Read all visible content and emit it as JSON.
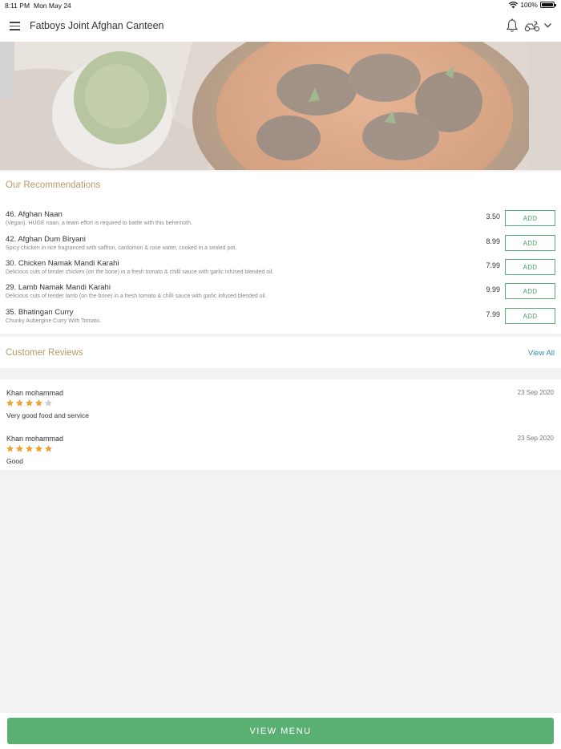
{
  "status_bar": {
    "time": "8:11 PM",
    "date": "Mon May 24",
    "battery": "100%"
  },
  "header": {
    "title": "Fatboys Joint Afghan Canteen",
    "icons": [
      "menu-icon",
      "bell-icon",
      "scooter-icon",
      "chevron-down-icon"
    ]
  },
  "recommendations": {
    "title": "Our Recommendations",
    "items": [
      {
        "name": "46. Afghan Naan",
        "desc": "(Vegan). HUGE naan, a team effort is required to battle with this behemoth.",
        "price": "3.50",
        "button": "ADD"
      },
      {
        "name": "42. Afghan Dum Biryani",
        "desc": "Spicy chicken in rice fragranced with saffron, cardomon & rose water, cooked in a sealed pot.",
        "price": "8.99",
        "button": "ADD"
      },
      {
        "name": "30. Chicken Namak Mandi Karahi",
        "desc": "Delicious cuts of tender chicken (on the bone) in a fresh tomato & chilli sauce with garlic infused blended oil.",
        "price": "7.99",
        "button": "ADD"
      },
      {
        "name": "29. Lamb Namak Mandi Karahi",
        "desc": "Delicious cuts of tender lamb (on the bone) in a fresh tomato & chilli sauce with garlic infused blended oil.",
        "price": "9.99",
        "button": "ADD"
      },
      {
        "name": "35. Bhatingan Curry",
        "desc": "Chunky Aubergine Curry With Tomato.",
        "price": "7.99",
        "button": "ADD"
      }
    ]
  },
  "reviews": {
    "title": "Customer Reviews",
    "view_all": "View All",
    "items": [
      {
        "name": "Khan mohammad",
        "date": "23 Sep 2020",
        "rating": 4,
        "text": "Very good food and service"
      },
      {
        "name": "Khan mohammad",
        "date": "23 Sep 2020",
        "rating": 5,
        "text": "Good"
      }
    ]
  },
  "colors": {
    "accent_green": "#5aaf72",
    "section_title": "#b89a6a",
    "link_blue": "#2a8fb5",
    "star_filled": "#f0a030",
    "star_empty": "#cccccc"
  },
  "footer": {
    "button": "VIEW MENU"
  }
}
